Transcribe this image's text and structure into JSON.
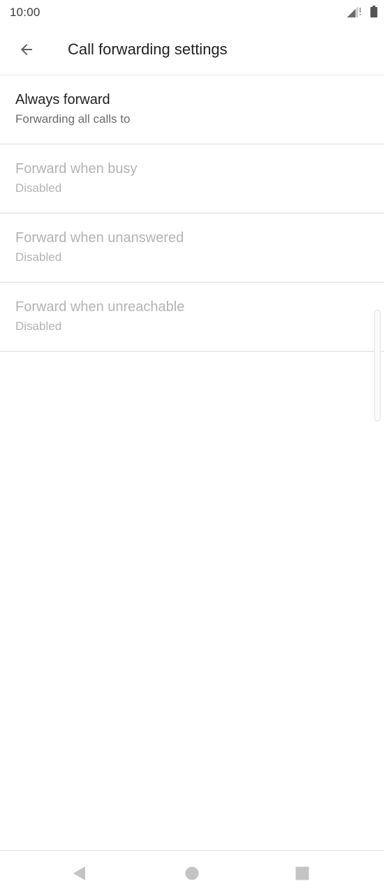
{
  "status_bar": {
    "time": "10:00",
    "icons": [
      "signal-icon",
      "battery-icon"
    ]
  },
  "toolbar": {
    "back_icon": "arrow-back-icon",
    "title": "Call forwarding settings"
  },
  "settings": {
    "items": [
      {
        "title": "Always forward",
        "summary": "Forwarding all calls to",
        "enabled": true
      },
      {
        "title": "Forward when busy",
        "summary": "Disabled",
        "enabled": false
      },
      {
        "title": "Forward when unanswered",
        "summary": "Disabled",
        "enabled": false
      },
      {
        "title": "Forward when unreachable",
        "summary": "Disabled",
        "enabled": false
      }
    ]
  },
  "nav_bar": {
    "buttons": [
      "nav-back-icon",
      "nav-home-icon",
      "nav-recents-icon"
    ]
  },
  "colors": {
    "text_primary": "#212121",
    "text_secondary": "#6b6b6b",
    "text_disabled": "#b3b3b3",
    "divider": "#dcdcdc",
    "icon": "#5f5f5f",
    "nav_icon": "#c4c4c4"
  }
}
